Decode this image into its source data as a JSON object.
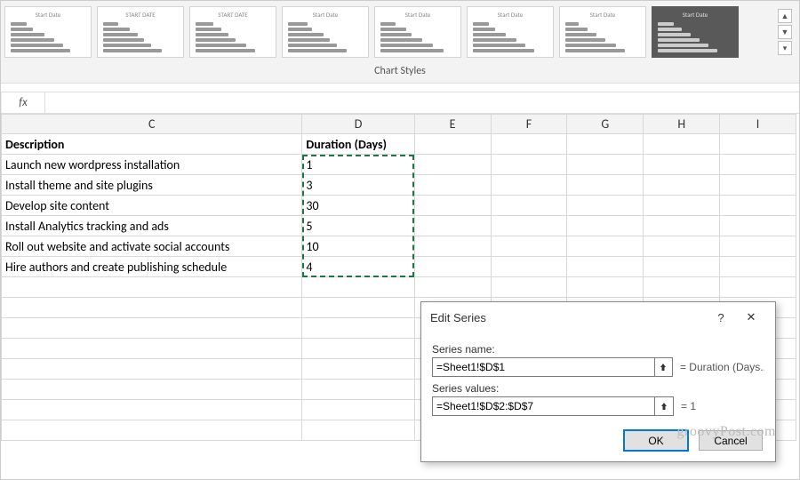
{
  "ribbon": {
    "group_label": "Chart Styles",
    "thumbs": [
      {
        "title": "Start Date",
        "bars": [
          22,
          30,
          45,
          58,
          70,
          80
        ],
        "dark": false
      },
      {
        "title": "START DATE",
        "bars": [
          20,
          36,
          46,
          55,
          64,
          78
        ],
        "dark": false
      },
      {
        "title": "START DATE",
        "bars": [
          24,
          34,
          44,
          54,
          68,
          80
        ],
        "dark": false
      },
      {
        "title": "Start Date",
        "bars": [
          26,
          32,
          48,
          56,
          66,
          78
        ],
        "dark": false
      },
      {
        "title": "Start Date",
        "bars": [
          20,
          34,
          42,
          56,
          70,
          84
        ],
        "dark": false
      },
      {
        "title": "Start Date",
        "bars": [
          22,
          30,
          44,
          58,
          70,
          82
        ],
        "dark": false
      },
      {
        "title": "Start Date",
        "bars": [
          18,
          30,
          42,
          54,
          68,
          80
        ],
        "dark": false
      },
      {
        "title": "Start Date",
        "bars": [
          22,
          32,
          44,
          56,
          68,
          80
        ],
        "dark": true
      }
    ]
  },
  "formula_bar": {
    "fx": "fx",
    "value": ""
  },
  "columns": [
    "C",
    "D",
    "E",
    "F",
    "G",
    "H",
    "I"
  ],
  "headers": {
    "c": "Description",
    "d": "Duration (Days)"
  },
  "rows": [
    {
      "desc": "Launch new wordpress installation",
      "dur": "1"
    },
    {
      "desc": "Install theme and site plugins",
      "dur": "3"
    },
    {
      "desc": "Develop site content",
      "dur": "30"
    },
    {
      "desc": "Install Analytics tracking and ads",
      "dur": "5"
    },
    {
      "desc": "Roll out website and activate social accounts",
      "dur": "10"
    },
    {
      "desc": "Hire authors and create publishing schedule",
      "dur": "4"
    }
  ],
  "dialog": {
    "title": "Edit Series",
    "help": "?",
    "close": "✕",
    "series_name_label": "Series name:",
    "series_name_value": "=Sheet1!$D$1",
    "series_name_eq": "= Duration (Days...",
    "series_values_label": "Series values:",
    "series_values_value": "=Sheet1!$D$2:$D$7",
    "series_values_eq": "= 1",
    "ok": "OK",
    "cancel": "Cancel"
  },
  "watermark": "groovyPost.com",
  "chart_data": {
    "type": "bar",
    "categories": [
      "Launch new wordpress installation",
      "Install theme and site plugins",
      "Develop site content",
      "Install Analytics tracking and ads",
      "Roll out website and activate social accounts",
      "Hire authors and create publishing schedule"
    ],
    "values": [
      1,
      3,
      30,
      5,
      10,
      4
    ],
    "title": "Duration (Days)",
    "xlabel": "",
    "ylabel": "",
    "ylim": [
      0,
      30
    ]
  }
}
